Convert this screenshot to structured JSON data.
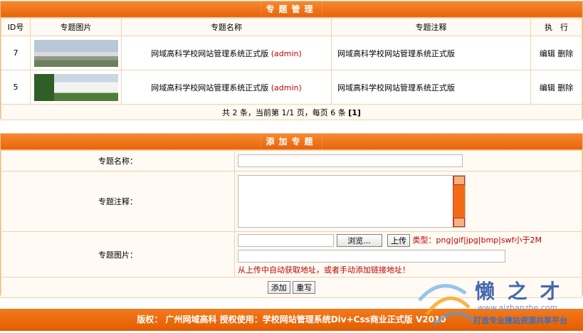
{
  "list": {
    "title": "专题管理",
    "headers": [
      "ID号",
      "专题图片",
      "专题名称",
      "专题注释",
      "执　行"
    ],
    "rows": [
      {
        "id": "7",
        "name": "网域高科学校网站管理系统正式版",
        "author": "(admin)",
        "note": "网域高科学校网站管理系统正式版",
        "edit": "编辑",
        "del": "删除"
      },
      {
        "id": "5",
        "name": "网域高科学校网站管理系统正式版",
        "author": "(admin)",
        "note": "网域高科学校网站管理系统正式版",
        "edit": "编辑",
        "del": "删除"
      }
    ],
    "pager": "共 2 条，当前第 1/1 页，每页 6 条",
    "pager_link": "[1]"
  },
  "form": {
    "title": "添加专题",
    "name_label": "专题名称：",
    "note_label": "专题注释：",
    "image_label": "专题图片：",
    "browse": "浏览...",
    "upload": "上传",
    "types": "类型：png|gif|jpg|bmp|swf小于2M",
    "hint": "从上传中自动获取地址，或者手动添加链接地址！",
    "add": "添加",
    "reset": "重写"
  },
  "footer": "版权： 广州网域高科 授权使用：学校网站管理系统Div+Css商业正式版 V2010",
  "watermark": {
    "brand": "懒 之 才",
    "url": "www.aizhanzhe.com",
    "slogan": "打造专业建站资源共享平台"
  }
}
